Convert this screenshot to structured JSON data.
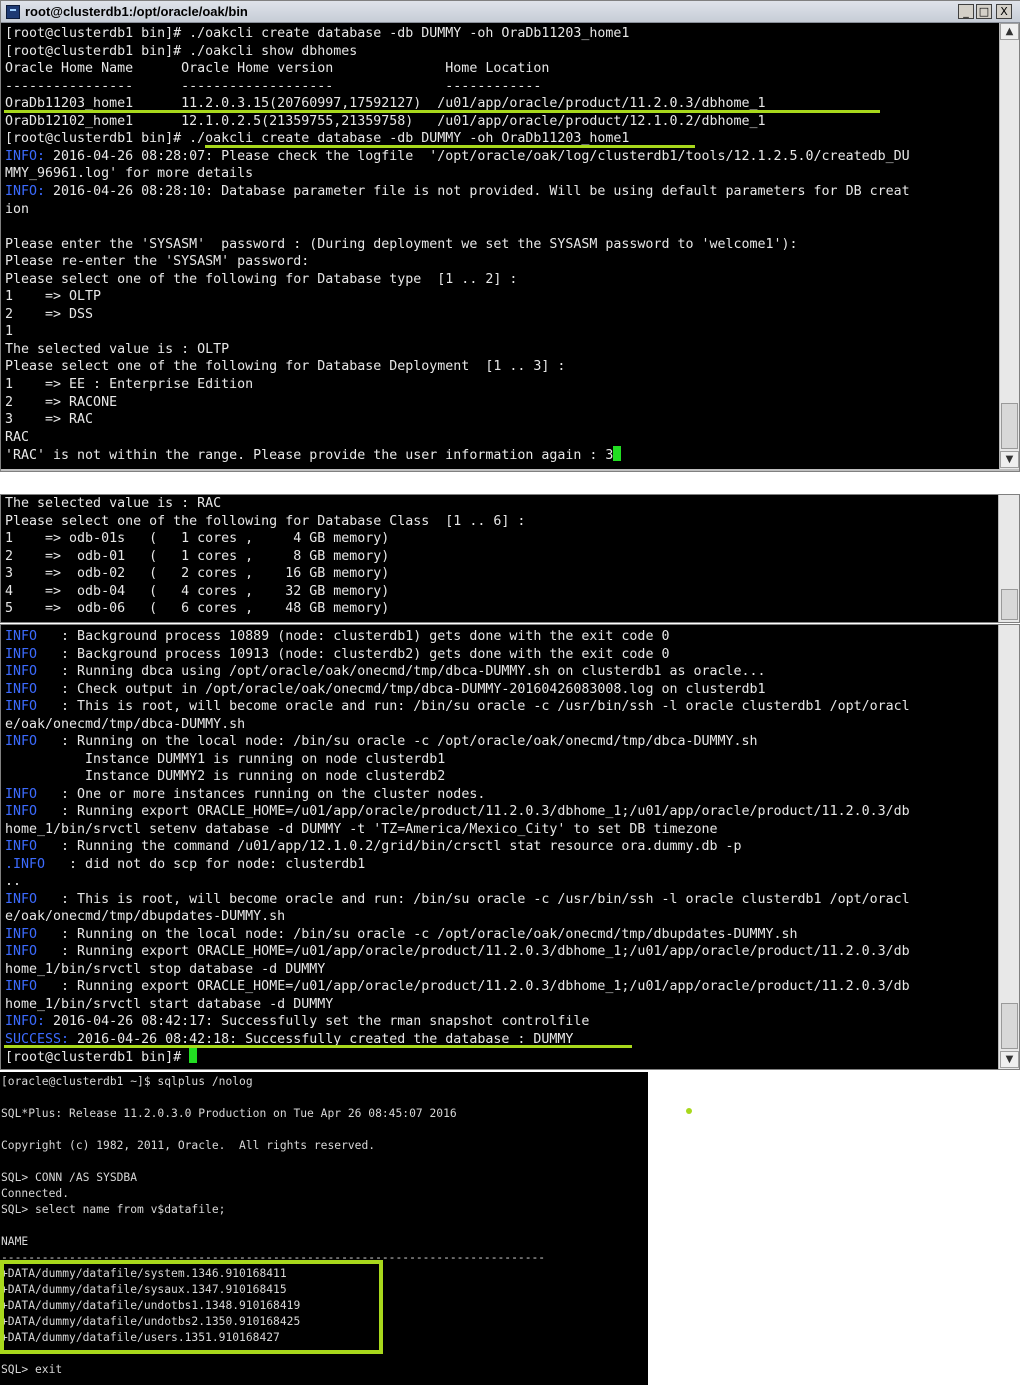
{
  "window": {
    "title": "root@clusterdb1:/opt/oracle/oak/bin",
    "buttons": [
      "_",
      "□",
      "X"
    ]
  },
  "scroll": {
    "up": "▲",
    "down": "▼"
  },
  "terminal1": {
    "lines": [
      {
        "t": "[root@clusterdb1 bin]# ./oakcli create database -db DUMMY -oh OraDb11203_home1"
      },
      {
        "t": "[root@clusterdb1 bin]# ./oakcli show dbhomes"
      },
      {
        "t": "Oracle Home Name      Oracle Home version              Home Location"
      },
      {
        "t": "----------------      -------------------              ------------"
      },
      {
        "t": "OraDb11203_home1      11.2.0.3.15(20760997,17592127)  /u01/app/oracle/product/11.2.0.3/dbhome_1"
      },
      {
        "t": "OraDb12102_home1      12.1.0.2.5(21359755,21359758)   /u01/app/oracle/product/12.1.0.2/dbhome_1"
      },
      {
        "t": "[root@clusterdb1 bin]# ./oakcli create database -db DUMMY -oh OraDb11203_home1"
      },
      {
        "p": "INFO:",
        "t": " 2016-04-26 08:28:07: Please check the logfile  '/opt/oracle/oak/log/clusterdb1/tools/12.1.2.5.0/createdb_DU"
      },
      {
        "t": "MMY_96961.log' for more details"
      },
      {
        "p": "INFO:",
        "t": " 2016-04-26 08:28:10: Database parameter file is not provided. Will be using default parameters for DB creat"
      },
      {
        "t": "ion"
      },
      {
        "t": ""
      },
      {
        "t": "Please enter the 'SYSASM'  password : (During deployment we set the SYSASM password to 'welcome1'):"
      },
      {
        "t": "Please re-enter the 'SYSASM' password:"
      },
      {
        "t": "Please select one of the following for Database type  [1 .. 2] :"
      },
      {
        "t": "1    => OLTP"
      },
      {
        "t": "2    => DSS"
      },
      {
        "t": "1"
      },
      {
        "t": "The selected value is : OLTP"
      },
      {
        "t": "Please select one of the following for Database Deployment  [1 .. 3] :"
      },
      {
        "t": "1    => EE : Enterprise Edition"
      },
      {
        "t": "2    => RACONE"
      },
      {
        "t": "3    => RAC"
      },
      {
        "t": "RAC"
      },
      {
        "t": "'RAC' is not within the range. Please provide the user information again : 3",
        "cursor": true
      }
    ]
  },
  "terminal2": {
    "lines": [
      {
        "t": "The selected value is : RAC"
      },
      {
        "t": "Please select one of the following for Database Class  [1 .. 6] :"
      },
      {
        "t": "1    => odb-01s   (   1 cores ,     4 GB memory)"
      },
      {
        "t": "2    =>  odb-01   (   1 cores ,     8 GB memory)"
      },
      {
        "t": "3    =>  odb-02   (   2 cores ,    16 GB memory)"
      },
      {
        "t": "4    =>  odb-04   (   4 cores ,    32 GB memory)"
      },
      {
        "t": "5    =>  odb-06   (   6 cores ,    48 GB memory)"
      }
    ]
  },
  "terminal3": {
    "lines": [
      {
        "p": "INFO",
        "t": "   : Background process 10889 (node: clusterdb1) gets done with the exit code 0"
      },
      {
        "p": "INFO",
        "t": "   : Background process 10913 (node: clusterdb2) gets done with the exit code 0"
      },
      {
        "p": "INFO",
        "t": "   : Running dbca using /opt/oracle/oak/onecmd/tmp/dbca-DUMMY.sh on clusterdb1 as oracle..."
      },
      {
        "p": "INFO",
        "t": "   : Check output in /opt/oracle/oak/onecmd/tmp/dbca-DUMMY-20160426083008.log on clusterdb1"
      },
      {
        "p": "INFO",
        "t": "   : This is root, will become oracle and run: /bin/su oracle -c /usr/bin/ssh -l oracle clusterdb1 /opt/oracl"
      },
      {
        "t": "e/oak/onecmd/tmp/dbca-DUMMY.sh"
      },
      {
        "p": "INFO",
        "t": "   : Running on the local node: /bin/su oracle -c /opt/oracle/oak/onecmd/tmp/dbca-DUMMY.sh"
      },
      {
        "t": "          Instance DUMMY1 is running on node clusterdb1"
      },
      {
        "t": "          Instance DUMMY2 is running on node clusterdb2"
      },
      {
        "p": "INFO",
        "t": "   : One or more instances running on the cluster nodes."
      },
      {
        "p": "INFO",
        "t": "   : Running export ORACLE_HOME=/u01/app/oracle/product/11.2.0.3/dbhome_1;/u01/app/oracle/product/11.2.0.3/db"
      },
      {
        "t": "home_1/bin/srvctl setenv database -d DUMMY -t 'TZ=America/Mexico_City' to set DB timezone"
      },
      {
        "p": "INFO",
        "t": "   : Running the command /u01/app/12.1.0.2/grid/bin/crsctl stat resource ora.dummy.db -p"
      },
      {
        "p": ".INFO",
        "t": "   : did not do scp for node: clusterdb1"
      },
      {
        "t": ".."
      },
      {
        "p": "INFO",
        "t": "   : This is root, will become oracle and run: /bin/su oracle -c /usr/bin/ssh -l oracle clusterdb1 /opt/oracl"
      },
      {
        "t": "e/oak/onecmd/tmp/dbupdates-DUMMY.sh"
      },
      {
        "p": "INFO",
        "t": "   : Running on the local node: /bin/su oracle -c /opt/oracle/oak/onecmd/tmp/dbupdates-DUMMY.sh"
      },
      {
        "p": "INFO",
        "t": "   : Running export ORACLE_HOME=/u01/app/oracle/product/11.2.0.3/dbhome_1;/u01/app/oracle/product/11.2.0.3/db"
      },
      {
        "t": "home_1/bin/srvctl stop database -d DUMMY"
      },
      {
        "p": "INFO",
        "t": "   : Running export ORACLE_HOME=/u01/app/oracle/product/11.2.0.3/dbhome_1;/u01/app/oracle/product/11.2.0.3/db"
      },
      {
        "t": "home_1/bin/srvctl start database -d DUMMY"
      },
      {
        "p": "INFO:",
        "t": " 2016-04-26 08:42:17: Successfully set the rman snapshot controlfile"
      },
      {
        "p": "SUCCESS:",
        "t": " 2016-04-26 08:42:18: Successfully created the database : DUMMY"
      },
      {
        "t": "[root@clusterdb1 bin]# ",
        "cursor": true
      }
    ]
  },
  "sqlplus": {
    "lines": [
      "[oracle@clusterdb1 ~]$ sqlplus /nolog",
      "",
      "SQL*Plus: Release 11.2.0.3.0 Production on Tue Apr 26 08:45:07 2016",
      "",
      "Copyright (c) 1982, 2011, Oracle.  All rights reserved.",
      "",
      "SQL> CONN /AS SYSDBA",
      "Connected.",
      "SQL> select name from v$datafile;",
      "",
      "NAME",
      "--------------------------------------------------------------------------------",
      "+DATA/dummy/datafile/system.1346.910168411",
      "+DATA/dummy/datafile/sysaux.1347.910168415",
      "+DATA/dummy/datafile/undotbs1.1348.910168419",
      "+DATA/dummy/datafile/undotbs2.1350.910168425",
      "+DATA/dummy/datafile/users.1351.910168427",
      "",
      "SQL> exit"
    ]
  },
  "colors": {
    "highlight": "#a8d81c",
    "info": "#3c6bff",
    "cursor": "#22dd22"
  }
}
